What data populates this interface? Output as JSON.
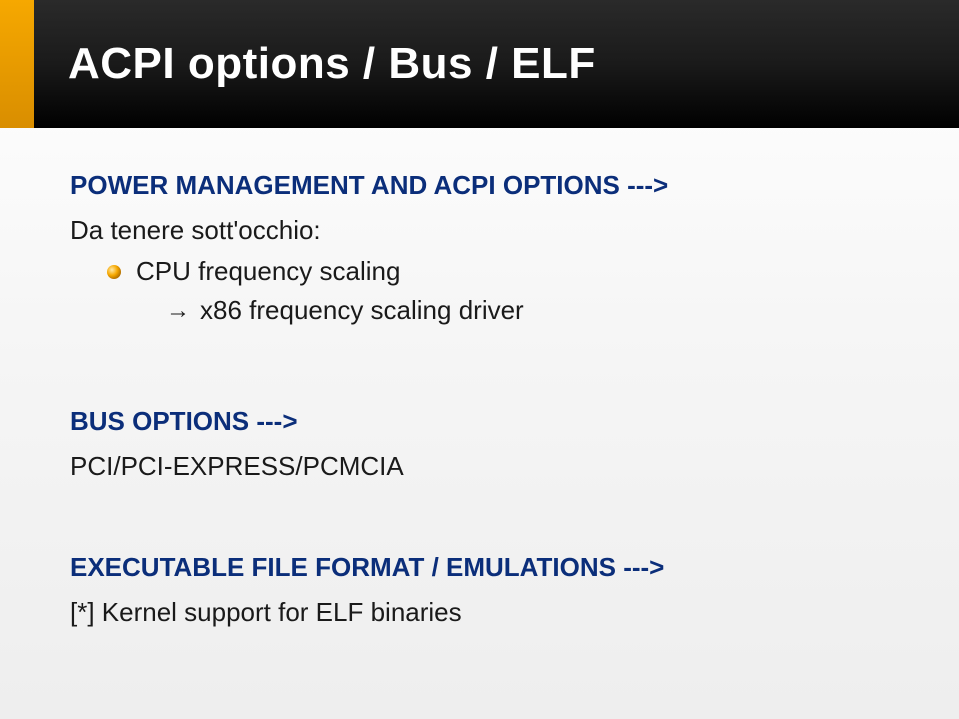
{
  "slide": {
    "title": "ACPI options / Bus / ELF",
    "sections": {
      "power": {
        "header": "POWER MANAGEMENT AND ACPI OPTIONS --->",
        "note": "Da tenere sott'occhio:",
        "bullet1": "CPU frequency scaling",
        "sub1_arrow": "→",
        "sub1": "x86 frequency scaling driver"
      },
      "bus": {
        "header": "BUS OPTIONS --->",
        "line1": "PCI/PCI-EXPRESS/PCMCIA"
      },
      "exec": {
        "header": "EXECUTABLE FILE FORMAT / EMULATIONS  --->",
        "line1": "[*] Kernel support for ELF binaries"
      }
    }
  }
}
